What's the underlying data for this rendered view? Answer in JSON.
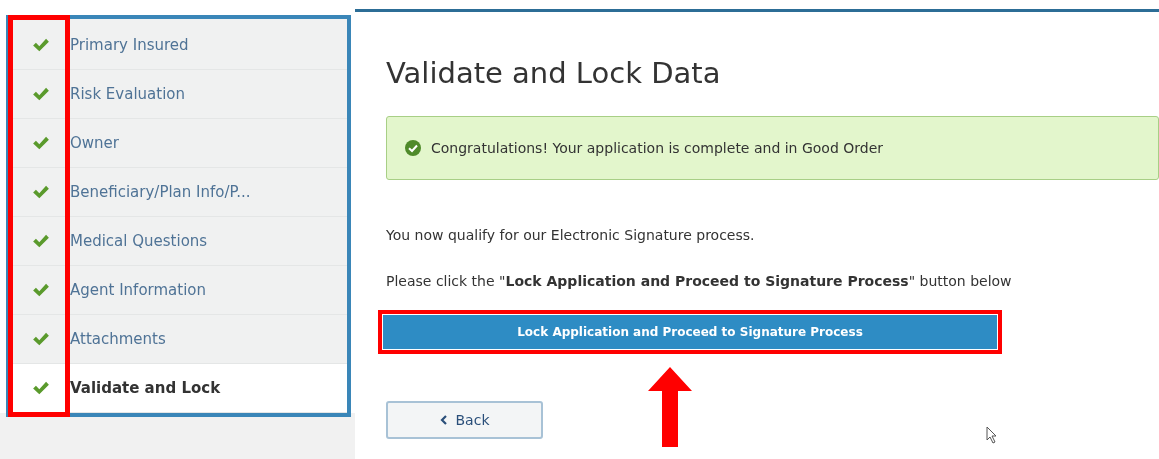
{
  "sidebar": {
    "items": [
      {
        "label": "Primary Insured",
        "completed": true,
        "selected": false
      },
      {
        "label": "Risk Evaluation",
        "completed": true,
        "selected": false
      },
      {
        "label": "Owner",
        "completed": true,
        "selected": false
      },
      {
        "label": "Beneficiary/Plan Info/P...",
        "completed": true,
        "selected": false
      },
      {
        "label": "Medical Questions",
        "completed": true,
        "selected": false
      },
      {
        "label": "Agent Information",
        "completed": true,
        "selected": false
      },
      {
        "label": "Attachments",
        "completed": true,
        "selected": false
      },
      {
        "label": "Validate and Lock",
        "completed": true,
        "selected": true
      }
    ]
  },
  "main": {
    "title": "Validate and Lock Data",
    "alert": {
      "kind": "success",
      "text": "Congratulations! Your application is complete and in Good Order"
    },
    "paragraphs": [
      "You now qualify for our Electronic Signature process.",
      "Please click the \"**Lock Application and Proceed to Signature Process**\" button below"
    ],
    "primary_button": "Lock Application and Proceed to Signature Process",
    "back_button": "Back"
  }
}
